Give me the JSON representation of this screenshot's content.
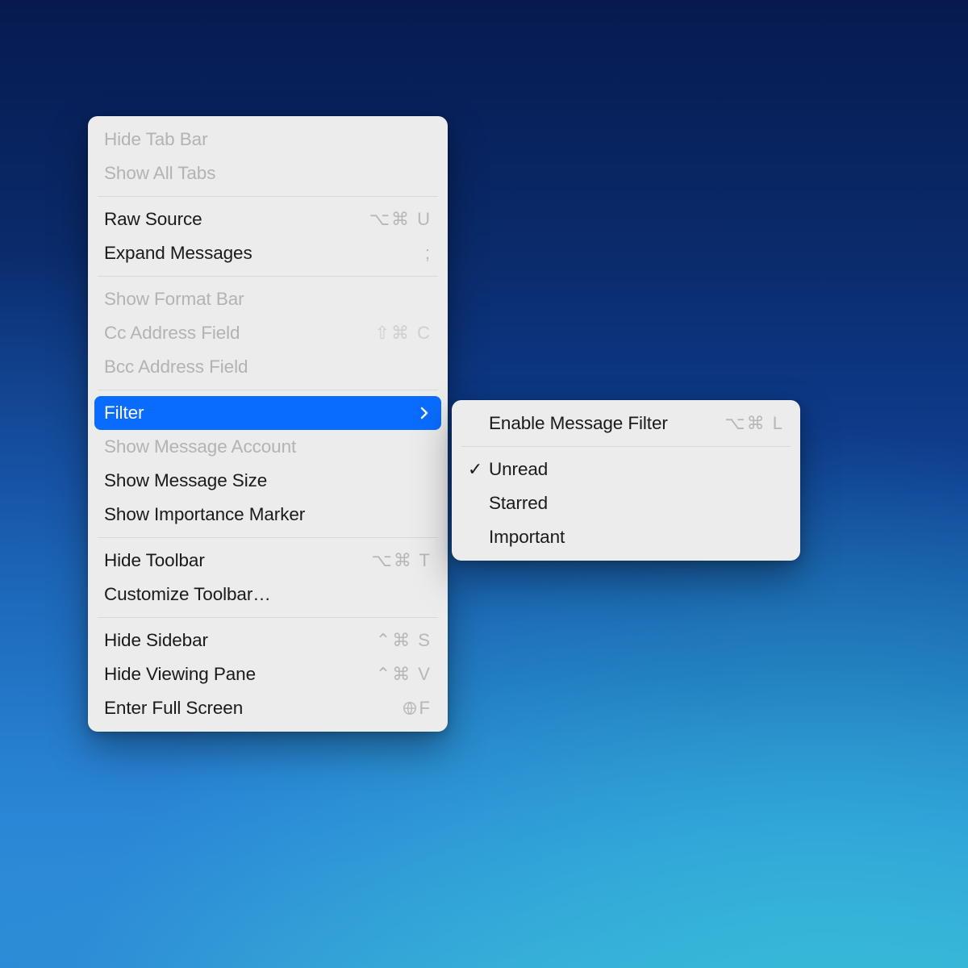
{
  "menu": {
    "hide_tab_bar": "Hide Tab Bar",
    "show_all_tabs": "Show All Tabs",
    "raw_source": {
      "label": "Raw Source",
      "shortcut": "⌥⌘ U"
    },
    "expand_messages": {
      "label": "Expand Messages",
      "shortcut": ";"
    },
    "show_format_bar": "Show Format Bar",
    "cc_address_field": {
      "label": "Cc Address Field",
      "shortcut": "⇧⌘ C"
    },
    "bcc_address_field": "Bcc Address Field",
    "filter": "Filter",
    "show_message_account": "Show Message Account",
    "show_message_size": "Show Message Size",
    "show_importance_marker": "Show Importance Marker",
    "hide_toolbar": {
      "label": "Hide Toolbar",
      "shortcut": "⌥⌘ T"
    },
    "customize_toolbar": "Customize Toolbar…",
    "hide_sidebar": {
      "label": "Hide Sidebar",
      "shortcut": "⌃⌘ S"
    },
    "hide_viewing_pane": {
      "label": "Hide Viewing Pane",
      "shortcut": "⌃⌘ V"
    },
    "enter_full_screen": {
      "label": "Enter Full Screen",
      "shortcut_letter": "F"
    }
  },
  "submenu": {
    "enable_message_filter": {
      "label": "Enable Message Filter",
      "shortcut": "⌥⌘ L"
    },
    "unread": {
      "label": "Unread",
      "checked": true
    },
    "starred": {
      "label": "Starred",
      "checked": false
    },
    "important": {
      "label": "Important",
      "checked": false
    }
  }
}
